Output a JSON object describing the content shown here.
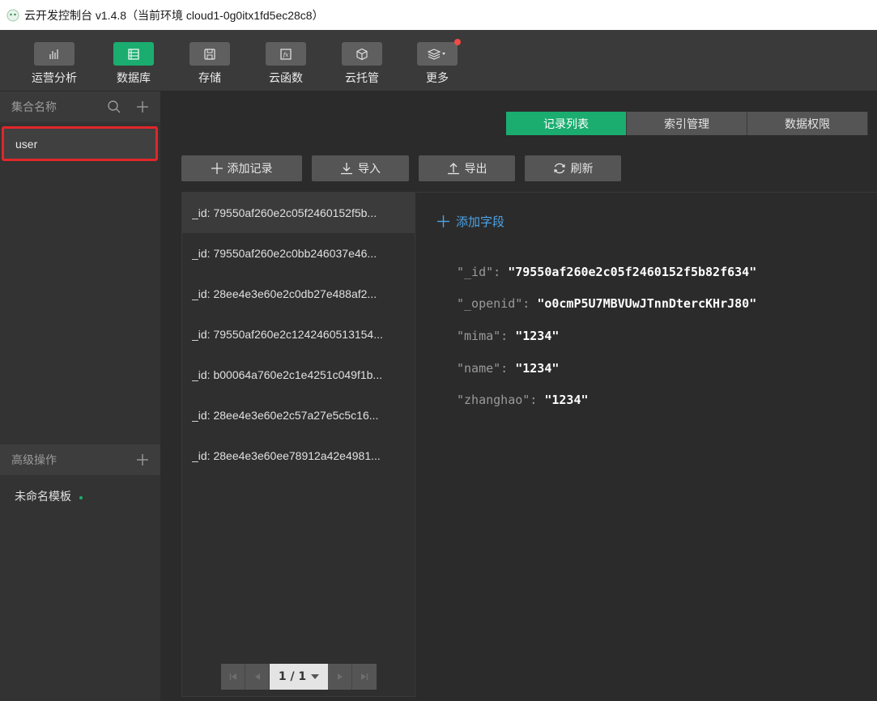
{
  "window": {
    "title": "云开发控制台 v1.4.8（当前环境 cloud1-0g0itx1fd5ec28c8）"
  },
  "toolbar": {
    "items": [
      {
        "label": "运营分析",
        "icon": "bar-chart-icon"
      },
      {
        "label": "数据库",
        "icon": "database-icon",
        "active": true
      },
      {
        "label": "存储",
        "icon": "storage-icon"
      },
      {
        "label": "云函数",
        "icon": "function-icon"
      },
      {
        "label": "云托管",
        "icon": "cube-icon"
      },
      {
        "label": "更多",
        "icon": "layers-icon",
        "badge": true
      }
    ]
  },
  "sidebar": {
    "collections_title": "集合名称",
    "collections": [
      "user"
    ],
    "advanced_title": "高级操作",
    "templates": [
      "未命名模板"
    ]
  },
  "tabs": [
    "记录列表",
    "索引管理",
    "数据权限"
  ],
  "actions": {
    "add": "添加记录",
    "import": "导入",
    "export": "导出",
    "refresh": "刷新"
  },
  "records": [
    "_id: 79550af260e2c05f2460152f5b...",
    "_id: 79550af260e2c0bb246037e46...",
    "_id: 28ee4e3e60e2c0db27e488af2...",
    "_id: 79550af260e2c1242460513154...",
    "_id: b00064a760e2c1e4251c049f1b...",
    "_id: 28ee4e3e60e2c57a27e5c5c16...",
    "_id: 28ee4e3e60ee78912a42e4981..."
  ],
  "pager": {
    "text": "1 / 1"
  },
  "detail": {
    "add_field": "添加字段",
    "fields": [
      {
        "key": "\"_id\":",
        "value": "\"79550af260e2c05f2460152f5b82f634\""
      },
      {
        "key": "\"_openid\":",
        "value": "\"o0cmP5U7MBVUwJTnnDtercKHrJ80\""
      },
      {
        "key": "\"mima\":",
        "value": "\"1234\""
      },
      {
        "key": "\"name\":",
        "value": "\"1234\""
      },
      {
        "key": "\"zhanghao\":",
        "value": "\"1234\""
      }
    ]
  },
  "colors": {
    "accent": "#1aad6f",
    "highlight_border": "#e0262a",
    "link": "#4aa3e8"
  }
}
